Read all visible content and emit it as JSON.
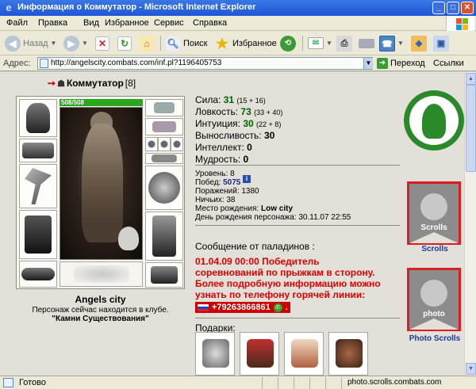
{
  "window": {
    "title": "Информация о Коммутатор - Microsoft Internet Explorer",
    "buttons": [
      "_",
      "□",
      "✕"
    ]
  },
  "menu": [
    "Файл",
    "Правка",
    "Вид",
    "Избранное",
    "Сервис",
    "Справка"
  ],
  "toolbar": {
    "back": "Назад",
    "search": "Поиск",
    "favorites": "Избранное"
  },
  "address": {
    "label": "Адрес:",
    "url": "http://angelscity.combats.com/inf.pl?1196405753",
    "go": "Переход",
    "links": "Ссылки"
  },
  "status": {
    "text": "Готово",
    "zone": "photo.scrolls.combats.com"
  },
  "character": {
    "name": "Коммутатор",
    "level": "[8]",
    "info_icon": "i",
    "hp": "508/508",
    "city": "Angels city",
    "club_note": "Персонаж сейчас находится в клубе.",
    "club_name": "\"Камни Существования\""
  },
  "stats": [
    {
      "label": "Сила:",
      "value": "31",
      "bonus": "(15 + 16)"
    },
    {
      "label": "Ловкость:",
      "value": "73",
      "bonus": "(33 + 40)"
    },
    {
      "label": "Интуиция:",
      "value": "30",
      "bonus": "(22 + 8)"
    },
    {
      "label": "Выносливость:",
      "value": "30",
      "bonus": ""
    },
    {
      "label": "Интеллект:",
      "value": "0",
      "bonus": ""
    },
    {
      "label": "Мудрость:",
      "value": "0",
      "bonus": ""
    }
  ],
  "info": {
    "level": "Уровень: 8",
    "wins_label": "Побед:",
    "wins": "5075",
    "losses": "Поражений: 1380",
    "draws": "Ничьих: 38",
    "birthplace_label": "Место рождения:",
    "birthplace": "Low city",
    "birthday": "День рождения персонажа: 30.11.07 22:55"
  },
  "paladin": {
    "heading": "Сообщение от паладинов :",
    "lines": [
      "01.04.09 00:00 Победитель",
      "соревнований по прыжкам в сторону.",
      "Более подробную информацию можно",
      "узнать по телефону горячей линии:"
    ],
    "phone": "+79263866861",
    "phone_suffix": "."
  },
  "gifts": {
    "heading": "Подарки:"
  },
  "sidebar": {
    "scrolls_banner": "Scrolls",
    "scrolls_link": "Scrolls",
    "photo_banner": "photo",
    "photo_link": "Photo Scrolls"
  },
  "colors": {
    "stat_value": "#006600",
    "paladin_text": "#e00000",
    "hp_bar": "#2aa71e",
    "banner_border": "#dc1e24"
  }
}
